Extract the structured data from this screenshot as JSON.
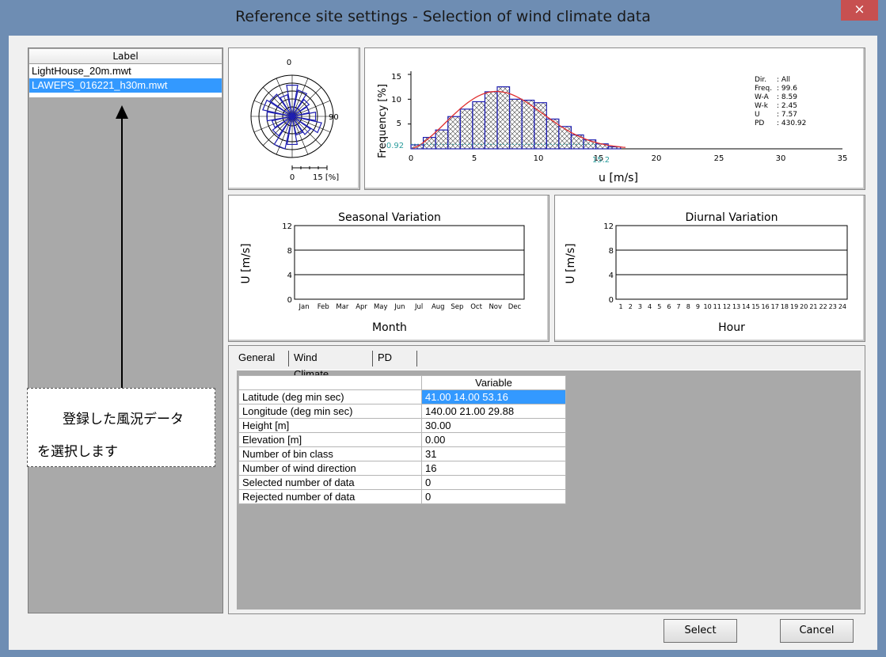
{
  "window": {
    "title": "Reference site settings - Selection of wind climate data",
    "close_glyph": "×"
  },
  "list": {
    "header": "Label",
    "items": [
      {
        "label": "LightHouse_20m.mwt",
        "selected": false
      },
      {
        "label": "LAWEPS_016221_h30m.mwt",
        "selected": true
      }
    ]
  },
  "callout": {
    "line1": "登録した風況データ",
    "line2": "を選択します"
  },
  "rose": {
    "north": "0",
    "east": "90",
    "scale_min": "0",
    "scale_max": "15 [%]"
  },
  "histogram": {
    "ylabel": "Frequency [%]",
    "xlabel": "u [m/s]",
    "yticks": [
      "15",
      "10",
      "5"
    ],
    "xticks": [
      "0",
      "5",
      "10",
      "15",
      "20",
      "25",
      "30",
      "35"
    ],
    "left_marker": "0.92",
    "right_marker": "15.2",
    "stats": [
      {
        "key": "Dir.",
        "val": ": All"
      },
      {
        "key": "Freq.",
        "val": ": 99.6"
      },
      {
        "key": "W-A",
        "val": ": 8.59"
      },
      {
        "key": "W-k",
        "val": ": 2.45"
      },
      {
        "key": "U",
        "val": ": 7.57"
      },
      {
        "key": "PD",
        "val": ": 430.92"
      }
    ]
  },
  "chart_data": [
    {
      "type": "bar",
      "title": "",
      "xlabel": "u [m/s]",
      "ylabel": "Frequency [%]",
      "xlim": [
        0,
        35
      ],
      "ylim": [
        0,
        15
      ],
      "x": [
        0,
        1,
        2,
        3,
        4,
        5,
        6,
        7,
        8,
        9,
        10,
        11,
        12,
        13,
        14,
        15,
        16
      ],
      "values": [
        0.8,
        2.3,
        3.8,
        6.5,
        8.0,
        9.5,
        11.5,
        12.5,
        10.0,
        9.8,
        9.3,
        6.0,
        4.5,
        2.8,
        1.8,
        1.0,
        0.4
      ]
    },
    {
      "type": "line",
      "title": "Seasonal Variation",
      "xlabel": "Month",
      "ylabel": "U [m/s]",
      "ylim": [
        0,
        12
      ],
      "yticks": [
        "12",
        "8",
        "4",
        "0"
      ],
      "categories": [
        "Jan",
        "Feb",
        "Mar",
        "Apr",
        "May",
        "Jun",
        "Jul",
        "Aug",
        "Sep",
        "Oct",
        "Nov",
        "Dec"
      ],
      "series": []
    },
    {
      "type": "line",
      "title": "Diurnal Variation",
      "xlabel": "Hour",
      "ylabel": "U [m/s]",
      "ylim": [
        0,
        12
      ],
      "yticks": [
        "12",
        "8",
        "4",
        "0"
      ],
      "categories": [
        "1",
        "2",
        "3",
        "4",
        "5",
        "6",
        "7",
        "8",
        "9",
        "10",
        "11",
        "12",
        "13",
        "14",
        "15",
        "16",
        "17",
        "18",
        "19",
        "20",
        "21",
        "22",
        "23",
        "24"
      ],
      "series": []
    }
  ],
  "tabs": [
    {
      "label": "General",
      "active": true
    },
    {
      "label": "Wind Climate",
      "active": false
    },
    {
      "label": "PD",
      "active": false
    }
  ],
  "table": {
    "header": "Variable",
    "rows": [
      {
        "key": "Latitude (deg min sec)",
        "value": "41.00 14.00 53.16",
        "selected": true
      },
      {
        "key": "Longitude (deg min sec)",
        "value": "140.00 21.00 29.88",
        "selected": false
      },
      {
        "key": "Height [m]",
        "value": "30.00",
        "selected": false
      },
      {
        "key": "Elevation [m]",
        "value": "0.00",
        "selected": false
      },
      {
        "key": "Number of bin class",
        "value": "31",
        "selected": false
      },
      {
        "key": "Number of wind direction",
        "value": "16",
        "selected": false
      },
      {
        "key": "Selected number of data",
        "value": "0",
        "selected": false
      },
      {
        "key": "Rejected number of data",
        "value": "0",
        "selected": false
      }
    ]
  },
  "buttons": {
    "select": "Select",
    "cancel": "Cancel"
  },
  "colors": {
    "selection": "#3399ff",
    "bar_outline": "#1f1fb0",
    "fit_curve": "#e03030",
    "marker": "#2a9c9c"
  }
}
